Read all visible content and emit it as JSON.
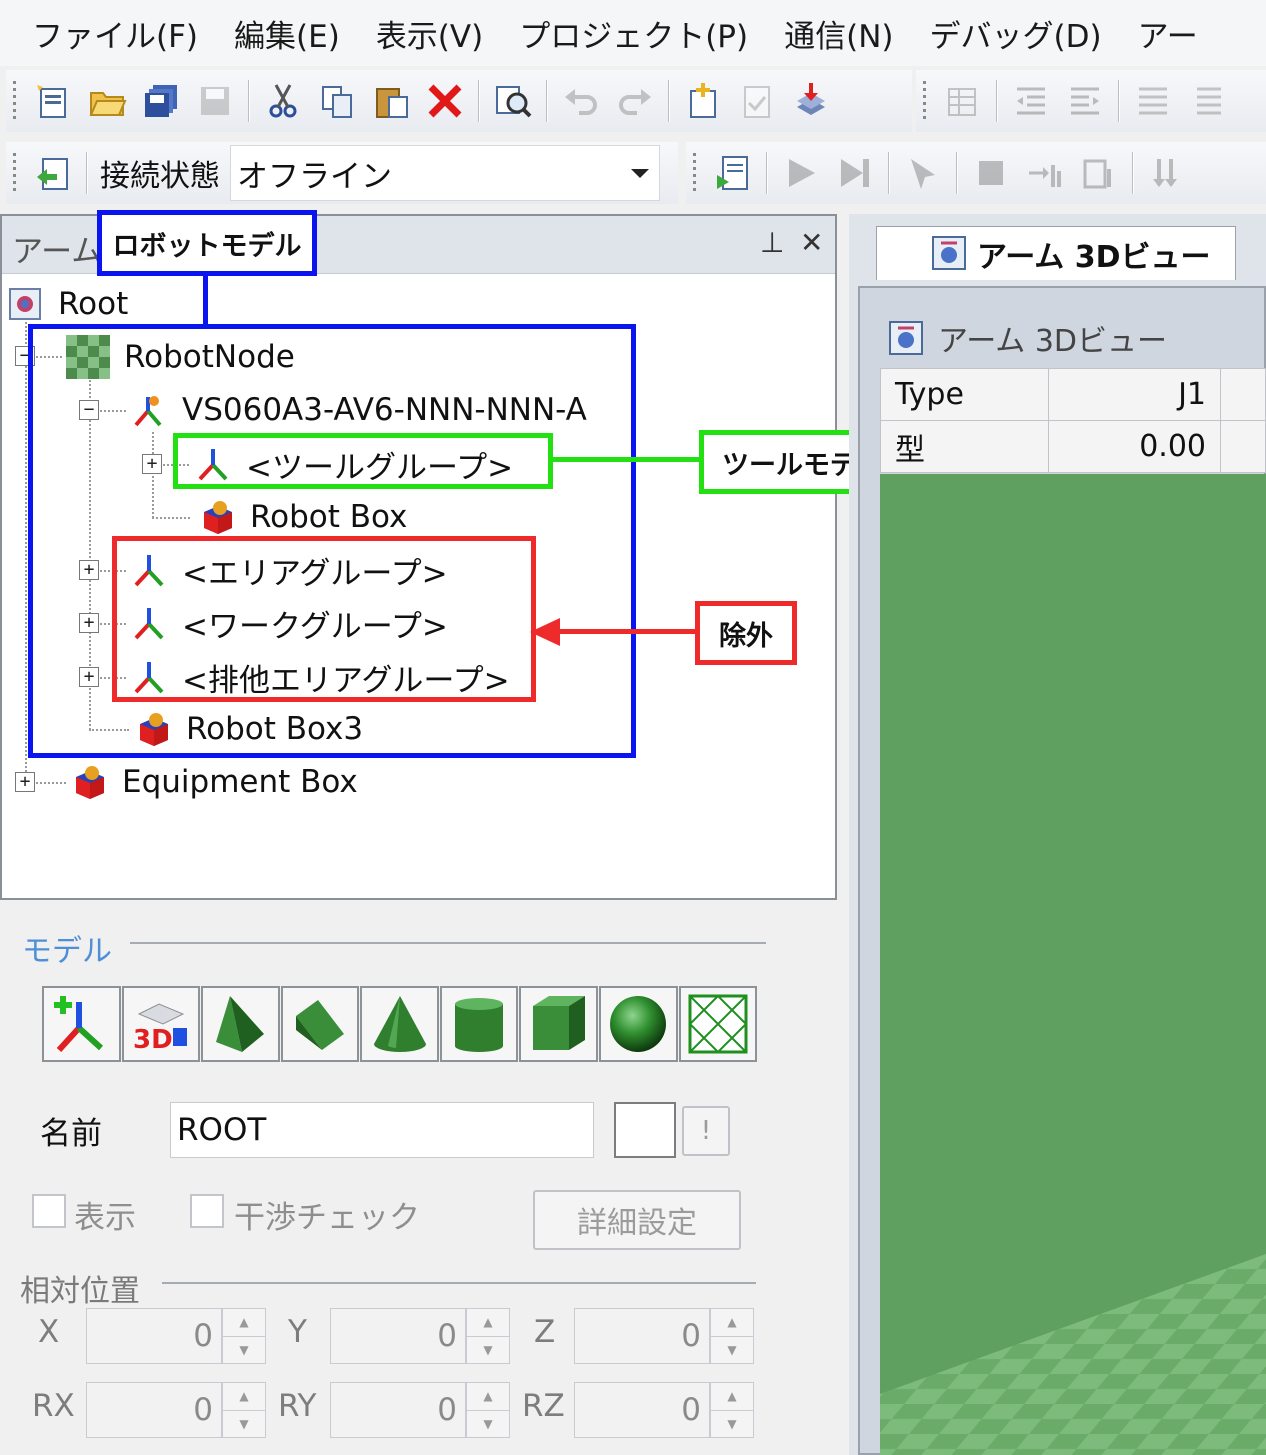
{
  "menu": [
    "ファイル(F)",
    "編集(E)",
    "表示(V)",
    "プロジェクト(P)",
    "通信(N)",
    "デバッグ(D)",
    "アー"
  ],
  "connection": {
    "label": "接続状態",
    "value": "オフライン"
  },
  "tree_panel": {
    "title": "アーム",
    "root": "Root",
    "robot_node": "RobotNode",
    "robot": "VS060A3-AV6-NNN-NNN-A",
    "tool_group": "<ツールグループ>",
    "robot_box": "Robot Box",
    "area_group": "<エリアグループ>",
    "work_group": "<ワークグループ>",
    "exclusive_group": "<排他エリアグループ>",
    "robot_box3": "Robot Box3",
    "equipment_box": "Equipment Box",
    "pin": "ᵖ",
    "close": "✕"
  },
  "annotations": {
    "robot_model": "ロボットモデル",
    "tool_model": "ツールモデル",
    "exclude": "除外",
    "colors": {
      "blue": "#0a14f0",
      "green": "#22e011",
      "red": "#ee2a2a"
    }
  },
  "view": {
    "tab": "アーム 3Dビュー",
    "title": "アーム 3Dビュー",
    "table": [
      [
        "Type",
        "J1"
      ],
      [
        "型",
        "0.00"
      ]
    ]
  },
  "model_panel": {
    "section": "モデル",
    "name_label": "名前",
    "name_value": "ROOT",
    "warn_button": "!",
    "show_label": "表示",
    "interference_label": "干渉チェック",
    "details_button": "詳細設定",
    "relative_section": "相対位置",
    "axes": [
      {
        "label": "X",
        "value": "0"
      },
      {
        "label": "Y",
        "value": "0"
      },
      {
        "label": "Z",
        "value": "0"
      },
      {
        "label": "RX",
        "value": "0"
      },
      {
        "label": "RY",
        "value": "0"
      },
      {
        "label": "RZ",
        "value": "0"
      }
    ]
  }
}
